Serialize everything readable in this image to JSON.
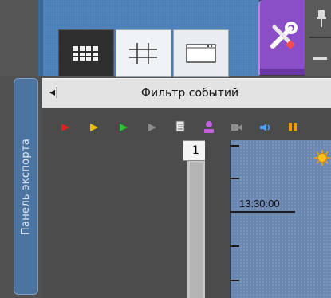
{
  "layout_buttons": [
    {
      "name": "grid",
      "icon": "grid-layout-icon"
    },
    {
      "name": "cross",
      "icon": "cross-layout-icon"
    },
    {
      "name": "single",
      "icon": "single-window-icon"
    }
  ],
  "tools": {
    "icon": "tools-icon"
  },
  "export_panel": {
    "label": "Панель экспорта"
  },
  "filter_panel": {
    "title": "Фильтр событий",
    "collapse_icon": "◂|"
  },
  "filter_toolbar": [
    {
      "icon": "play-red-icon",
      "color": "#e0201c"
    },
    {
      "icon": "play-yellow-icon",
      "color": "#f0c000"
    },
    {
      "icon": "play-green-icon",
      "color": "#2bc22b"
    },
    {
      "icon": "play-gray-icon",
      "color": "#8a8a8a"
    },
    {
      "icon": "document-icon",
      "color": "#e9e9e9"
    },
    {
      "icon": "user-icon",
      "color": "#c060e0"
    },
    {
      "icon": "camera-icon",
      "color": "#8f8f8f"
    },
    {
      "icon": "speaker-icon",
      "color": "#4aa3ff"
    },
    {
      "icon": "pause-orange-icon",
      "color": "#f39a00"
    }
  ],
  "camera": {
    "number": "1"
  },
  "timeline": {
    "time_label": "13:30:00",
    "weather_icon": "sun-icon"
  }
}
